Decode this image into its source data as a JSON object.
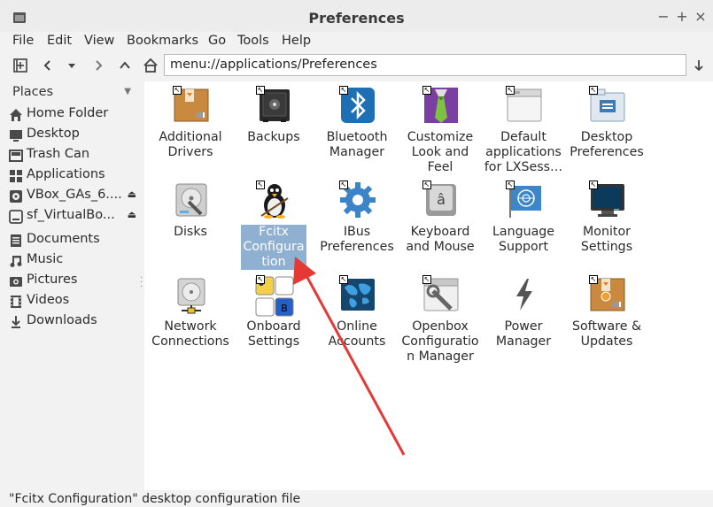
{
  "window": {
    "title": "Preferences",
    "controls": {
      "minimize": "−",
      "maximize": "+",
      "close": "×"
    }
  },
  "menubar": [
    "File",
    "Edit",
    "View",
    "Bookmarks",
    "Go",
    "Tools",
    "Help"
  ],
  "toolbar": {
    "address": "menu://applications/Preferences"
  },
  "sidebar": {
    "header": "Places",
    "items": [
      {
        "label": "Home Folder",
        "icon": "home-icon"
      },
      {
        "label": "Desktop",
        "icon": "desktop-icon"
      },
      {
        "label": "Trash Can",
        "icon": "trash-icon"
      },
      {
        "label": "Applications",
        "icon": "applications-icon"
      },
      {
        "label": "VBox_GAs_6....",
        "icon": "optical-disc-icon",
        "eject": "⏏"
      },
      {
        "label": "sf_VirtualBo...",
        "icon": "drive-icon",
        "eject": "⏏"
      },
      {
        "label": "Documents",
        "icon": "documents-icon"
      },
      {
        "label": "Music",
        "icon": "music-icon"
      },
      {
        "label": "Pictures",
        "icon": "pictures-icon"
      },
      {
        "label": "Videos",
        "icon": "videos-icon"
      },
      {
        "label": "Downloads",
        "icon": "downloads-icon"
      }
    ]
  },
  "content": {
    "items": [
      {
        "label": "Additional Drivers",
        "icon": "package-icon"
      },
      {
        "label": "Backups",
        "icon": "safe-icon"
      },
      {
        "label": "Bluetooth Manager",
        "icon": "bluetooth-icon"
      },
      {
        "label": "Customize Look and Feel",
        "icon": "tie-icon"
      },
      {
        "label": "Default applications for LXSess…",
        "icon": "window-icon"
      },
      {
        "label": "Desktop Preferences",
        "icon": "folder-desktop-icon"
      },
      {
        "label": "Disks",
        "icon": "disk-utility-icon"
      },
      {
        "label": "Fcitx Configuration",
        "icon": "penguin-icon"
      },
      {
        "label": "IBus Preferences",
        "icon": "gear-icon"
      },
      {
        "label": "Keyboard and Mouse",
        "icon": "keyboard-key-icon"
      },
      {
        "label": "Language Support",
        "icon": "un-flag-icon"
      },
      {
        "label": "Monitor Settings",
        "icon": "monitor-icon"
      },
      {
        "label": "Network Connections",
        "icon": "network-drive-icon"
      },
      {
        "label": "Onboard Settings",
        "icon": "onboard-keyboard-icon"
      },
      {
        "label": "Online Accounts",
        "icon": "world-map-icon"
      },
      {
        "label": "Openbox Configuration Manager",
        "icon": "openbox-icon"
      },
      {
        "label": "Power Manager",
        "icon": "power-bolt-icon"
      },
      {
        "label": "Software & Updates",
        "icon": "software-package-icon"
      }
    ]
  },
  "statusbar": {
    "text": "\"Fcitx Configuration\" desktop configuration file"
  },
  "colors": {
    "selection": "#8fb0d0",
    "annotation_arrow": "#e53935"
  }
}
